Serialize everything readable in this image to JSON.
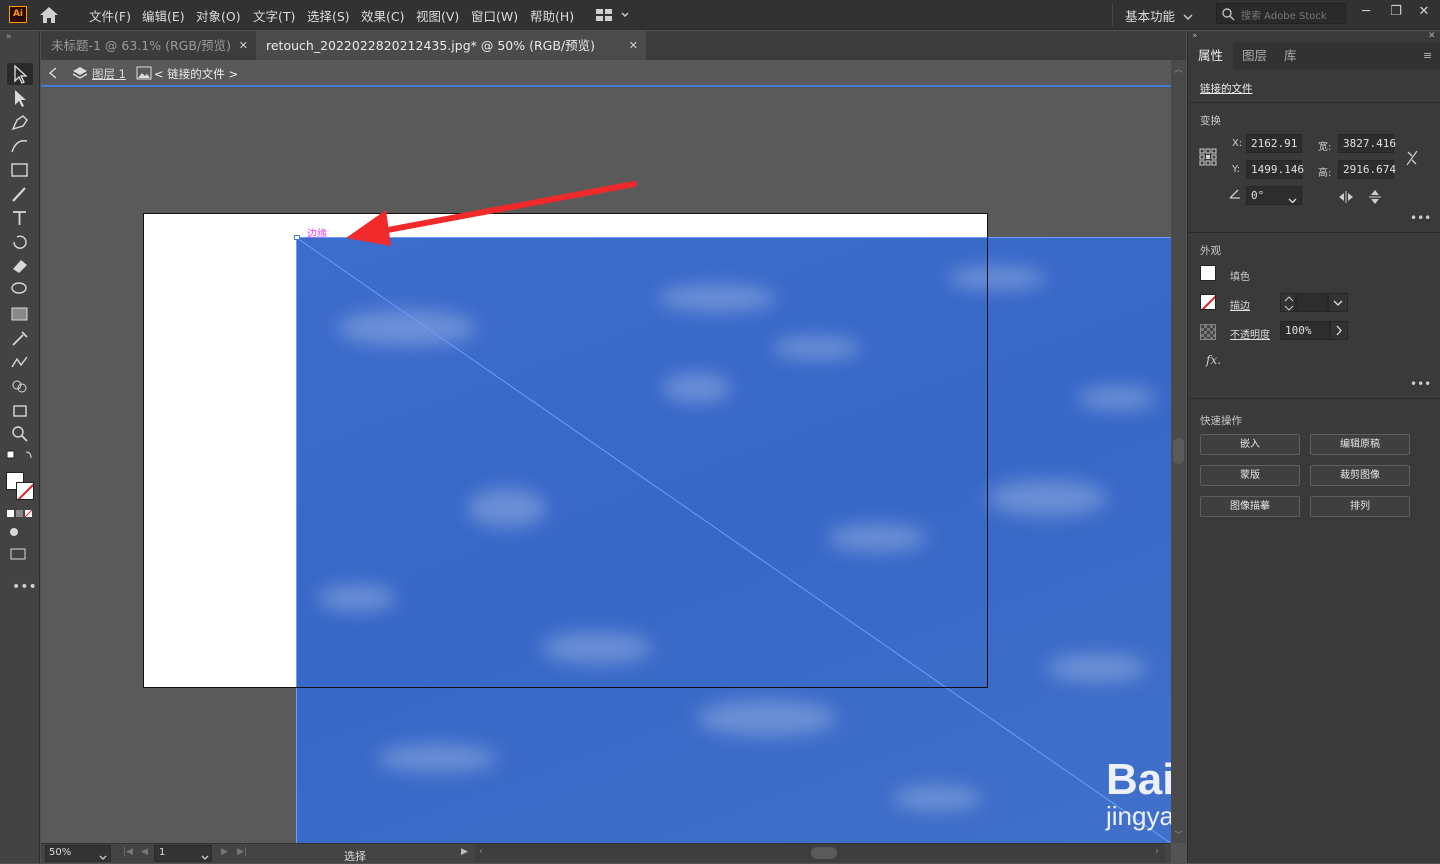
{
  "app": {
    "logo": "Ai"
  },
  "menubar": {
    "items": [
      "文件(F)",
      "编辑(E)",
      "对象(O)",
      "文字(T)",
      "选择(S)",
      "效果(C)",
      "视图(V)",
      "窗口(W)",
      "帮助(H)"
    ],
    "workspace": "基本功能",
    "search_placeholder": "搜索 Adobe Stock"
  },
  "tabs": [
    {
      "label": "未标题-1 @ 63.1% (RGB/预览)",
      "active": false
    },
    {
      "label": "retouch_2022022820212435.jpg* @ 50% (RGB/预览)",
      "active": true
    }
  ],
  "breadcrumb": {
    "layer": "图层 1",
    "item": "< 链接的文件 >"
  },
  "canvas": {
    "smart_guide_label": "边缘"
  },
  "statusbar": {
    "zoom": "50%",
    "artboard": "1",
    "tool": "选择"
  },
  "panel": {
    "tabs": [
      "属性",
      "图层",
      "库"
    ],
    "selection": "链接的文件",
    "transform": {
      "title": "变换",
      "x_label": "X:",
      "x": "2162.91",
      "y_label": "Y:",
      "y": "1499.146",
      "w_label": "宽:",
      "w": "3827.416",
      "h_label": "高:",
      "h": "2916.674",
      "angle": "0°"
    },
    "appearance": {
      "title": "外观",
      "fill": "填色",
      "stroke": "描边",
      "opacity_label": "不透明度",
      "opacity": "100%",
      "fx": "fx."
    },
    "quick": {
      "title": "快速操作",
      "buttons": [
        "嵌入",
        "编辑原稿",
        "蒙版",
        "裁剪图像",
        "图像描摹",
        "排列"
      ]
    }
  },
  "watermark": {
    "brand": "Bai du 经验",
    "url": "jingyan.baidu.com"
  },
  "colors": {
    "accent": "#4a7bd4",
    "sky": "#3a68c8",
    "annotation_arrow": "#f02a2a",
    "logo_bg": "#2b0b00",
    "logo_fg": "#ff9a00"
  }
}
